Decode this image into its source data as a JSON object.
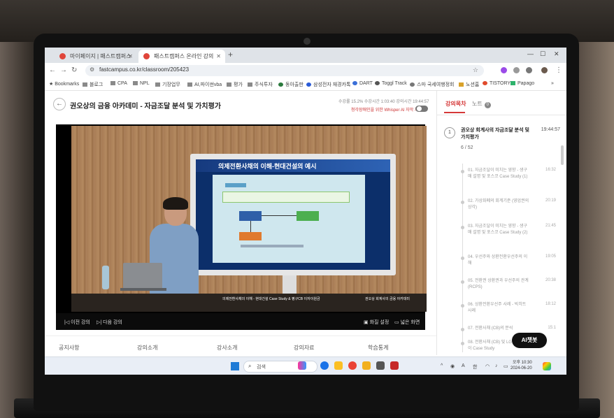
{
  "browser": {
    "tabs": [
      {
        "label": "마이페이지 | 패스트캠퍼스"
      },
      {
        "label": "패스트캠퍼스 온라인 강의"
      }
    ],
    "new_tab": "+",
    "url": "fastcampus.co.kr/classroom/205423",
    "bookmarks": [
      "Bookmarks",
      "블로그",
      "CPA",
      "NPL",
      "기장업무",
      "AI,파이썬vba",
      "평가",
      "주식투자",
      "동아출판",
      "삼성전자 재경카톡",
      "DART",
      "Toggl Track",
      "스마 국세여행정회",
      "노션홈",
      "TISTORY",
      "Papago"
    ]
  },
  "course": {
    "title": "권오상의 금융 아카데미 - 자금조달 분석 및 가치평가",
    "progress_text": "수강률 15.2%   수강시간 1:03:40  강의시간 19:44:57",
    "whisper_label": "청각장애인을 위한 Whisper AI 자막 자막"
  },
  "video": {
    "slide_title": "의제전환사채의 이해-현대건설의 예시",
    "caption_left": "의제전환사채의 이해 - 현대건설 Case Study & 평구CB 이자이원금",
    "caption_right": "권오상 회계사의 금융 아카데미",
    "prev_label": "이전 강의",
    "next_label": "다음 강의",
    "mode_label": "화질 설정",
    "wide_label": "넓은 화면"
  },
  "info_tabs": [
    "공지사항",
    "강의소개",
    "강사소개",
    "강의자료",
    "학습통계"
  ],
  "sidebar": {
    "tab_toc": "강의목차",
    "tab_notes": "노트",
    "notes_count": "0",
    "chapter": {
      "number": "1",
      "title": "권오상 회계사의 자금조달 분석 및 가치평가",
      "time": "19:44:57",
      "count": "6 / 52"
    },
    "lessons": [
      {
        "title": "01. 자금조달이 미치는 영향 - 생구매 설명 및 포스코 Case Study (1)",
        "time": "16:32"
      },
      {
        "title": "02. 가상화폐의 회계기준 (영업권의 상각)",
        "time": "20:19"
      },
      {
        "title": "03. 자금조달이 미치는 영향 - 생구매 설명 및 포스코 Case Study (2)",
        "time": "21:45"
      },
      {
        "title": "04. 우선주와 상환전환우선주의 이해",
        "time": "19:05"
      },
      {
        "title": "05. 전환권 상환권과 우선주의 관계 (RCPS)",
        "time": "20:38"
      },
      {
        "title": "06. 상환전환우선주 사례 - 빅히트 사례",
        "time": "18:12"
      },
      {
        "title": "07. 전환사채 (CB)의 분석",
        "time": "15:1"
      },
      {
        "title": "08. 전환사채 (CB) 및 LG디스플레이 Case Study",
        "time": ""
      }
    ],
    "ai_button": "AI챗봇"
  },
  "taskbar": {
    "search_label": "검색",
    "tray_lang": "A",
    "tray_ime": "한",
    "time": "오후 10:30",
    "date": "2024-06-20"
  }
}
